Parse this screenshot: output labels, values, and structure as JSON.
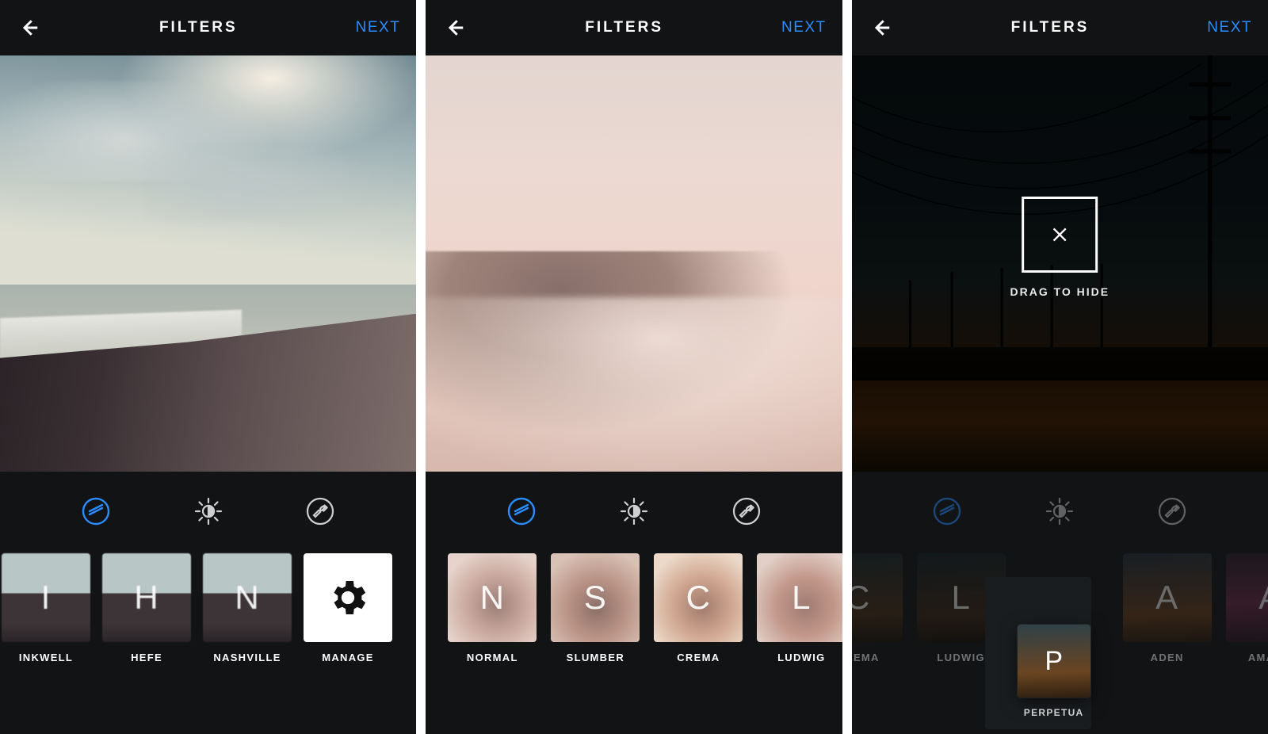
{
  "header": {
    "title": "FILTERS",
    "next": "NEXT"
  },
  "drag_hint": "DRAG TO HIDE",
  "screens": [
    {
      "scene": "beach",
      "filters": [
        {
          "glyph": "I",
          "label": "INKWELL"
        },
        {
          "glyph": "H",
          "label": "HEFE"
        },
        {
          "glyph": "N",
          "label": "NASHVILLE"
        },
        {
          "glyph": "",
          "label": "MANAGE",
          "manage": true
        }
      ]
    },
    {
      "scene": "mist",
      "filters": [
        {
          "glyph": "N",
          "label": "NORMAL"
        },
        {
          "glyph": "S",
          "label": "SLUMBER"
        },
        {
          "glyph": "C",
          "label": "CREMA"
        },
        {
          "glyph": "L",
          "label": "LUDWIG"
        }
      ]
    },
    {
      "scene": "dark",
      "dragging": {
        "glyph": "P",
        "label": "PERPETUA"
      },
      "filters": [
        {
          "glyph": "C",
          "label": "CREMA",
          "cut": "left"
        },
        {
          "glyph": "L",
          "label": "LUDWIG"
        },
        {
          "glyph": "",
          "label": "",
          "spacer": true
        },
        {
          "glyph": "A",
          "label": "ADEN"
        },
        {
          "glyph": "A",
          "label": "AMARO",
          "cut": "right"
        }
      ]
    }
  ]
}
